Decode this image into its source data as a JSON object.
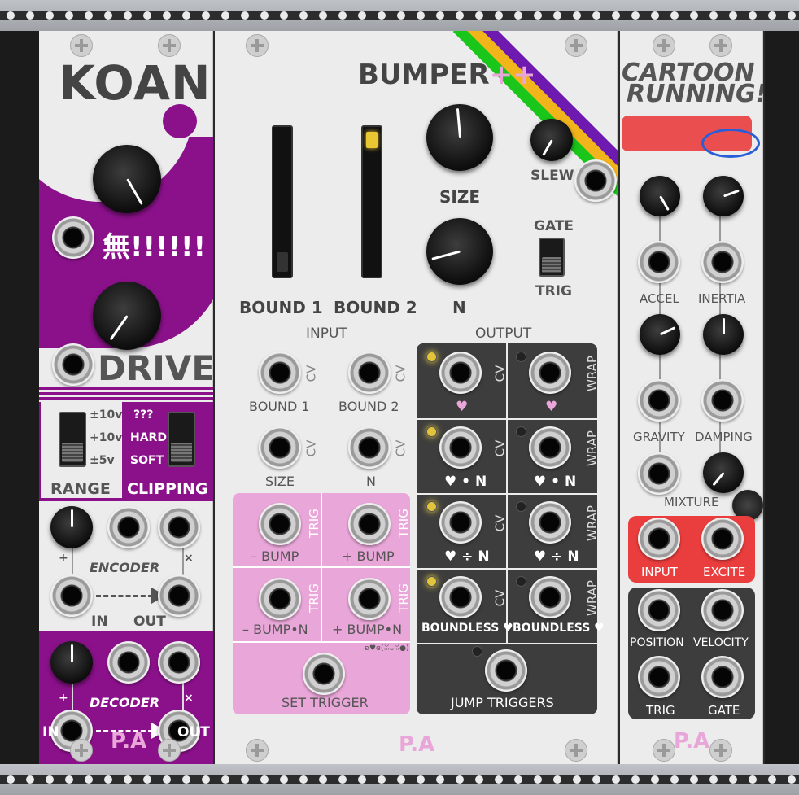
{
  "koan": {
    "title": "KOAN",
    "mu": "無!!!!!!",
    "drive": "DRIVE",
    "range_opts": [
      "±10v",
      "+10v",
      "±5v"
    ],
    "range_label": "RANGE",
    "clip_opts": [
      "???",
      "HARD",
      "SOFT"
    ],
    "clip_label": "CLIPPING",
    "encoder": "ENCODER",
    "decoder": "DECODER",
    "plus": "+",
    "times": "×",
    "in": "IN",
    "out": "OUT",
    "brand": "P.A"
  },
  "bumper": {
    "title": "BUMPER",
    "title_suffix": "++",
    "bound1": "BOUND 1",
    "bound2": "BOUND 2",
    "size": "SIZE",
    "n": "N",
    "slew": "SLEW",
    "gate": "GATE",
    "trig": "TRIG",
    "input": "INPUT",
    "output": "OUTPUT",
    "cv": "CV",
    "wrap": "WRAP",
    "minus_bump": "– BUMP",
    "plus_bump": "+ BUMP",
    "minus_bump_n": "– BUMP•N",
    "plus_bump_n": "+ BUMP•N",
    "set_trigger": "SET TRIGGER",
    "emote": "ʚ♥ɞ(ꈍᴗꈍ●)",
    "heart": "♥",
    "heart_n": "♥ • N",
    "heart_div_n": "♥ ÷ N",
    "boundless": "BOUNDLESS ♥",
    "jump_triggers": "JUMP TRIGGERS",
    "brand": "P.A"
  },
  "cartoon": {
    "title1": "CARTOON",
    "title2": "RUNNING!",
    "accel": "ACCEL",
    "inertia": "INERTIA",
    "gravity": "GRAVITY",
    "damping": "DAMPING",
    "mixture": "MIXTURE",
    "input": "INPUT",
    "excite": "EXCITE",
    "position": "POSITION",
    "velocity": "VELOCITY",
    "trig": "TRIG",
    "gate": "GATE",
    "brand": "P.A"
  },
  "colors": {
    "purple": "#8b118b",
    "pink": "#e9a6d8",
    "red": "#ea3d3d",
    "dark": "#3d3d3d"
  }
}
